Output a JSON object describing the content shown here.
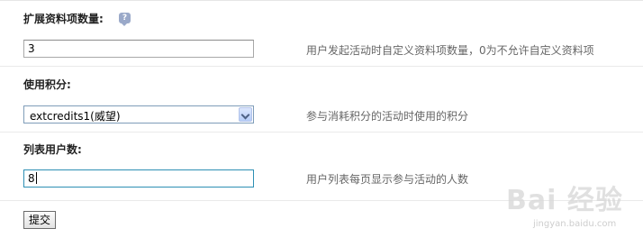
{
  "fields": [
    {
      "label": "扩展资料项数量:",
      "value": "3",
      "description": "用户发起活动时自定义资料项数量，0为不允许自定义资料项"
    },
    {
      "label": "使用积分:",
      "selected": "extcredits1(威望)",
      "description": "参与消耗积分的活动时使用的积分"
    },
    {
      "label": "列表用户数:",
      "value": "8",
      "description": "用户列表每页显示参与活动的人数"
    }
  ],
  "help_icon": "help-bubble-icon",
  "submit_label": "提交",
  "watermark": {
    "main": "Bai 经验",
    "sub": "jingyan.baidu.com"
  },
  "colors": {
    "label": "#222222",
    "description": "#666666",
    "focused_border": "#2d8fb4",
    "help_icon": "#9aa9c9"
  }
}
